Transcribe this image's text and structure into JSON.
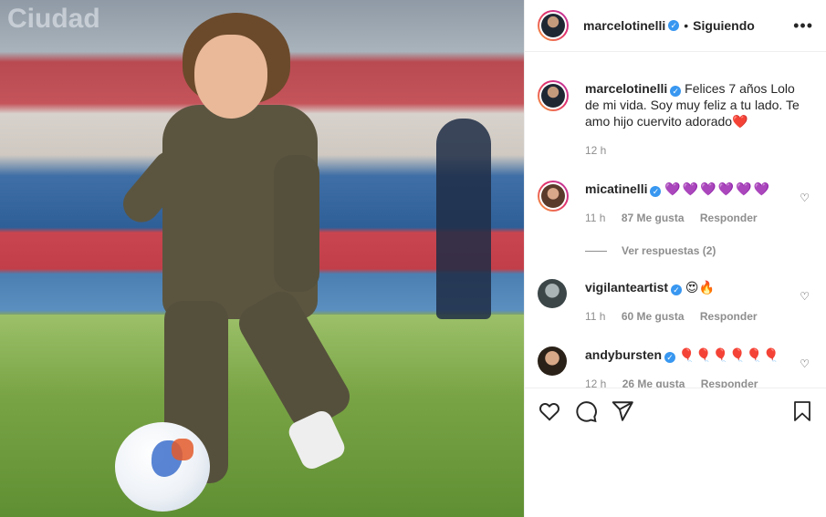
{
  "post": {
    "author": "marcelotinelli",
    "follow_status": "Siguiendo",
    "more_icon": "more-horizontal-icon",
    "caption": "Felices 7 años Lolo de mi vida. Soy muy feliz a tu lado. Te amo hijo cuervito adorado❤️",
    "caption_time": "12 h"
  },
  "comments": [
    {
      "username": "micatinelli",
      "text": "💜💜💜💜💜💜",
      "time": "11 h",
      "likes": "87 Me gusta",
      "reply": "Responder",
      "view_replies": "Ver respuestas (2)"
    },
    {
      "username": "vigilanteartist",
      "text": "😍🔥",
      "time": "11 h",
      "likes": "60 Me gusta",
      "reply": "Responder"
    },
    {
      "username": "andybursten",
      "text": "🎈🎈🎈🎈🎈🎈",
      "time": "12 h",
      "likes": "26 Me gusta",
      "reply": "Responder"
    }
  ],
  "photo": {
    "stadium_sign_text": "Ciudad"
  },
  "colors": {
    "verified": "#3897f0",
    "text": "#262626",
    "muted": "#8e8e8e",
    "heart_purple": "#8a5cf6",
    "heart_red": "#ed4956"
  }
}
